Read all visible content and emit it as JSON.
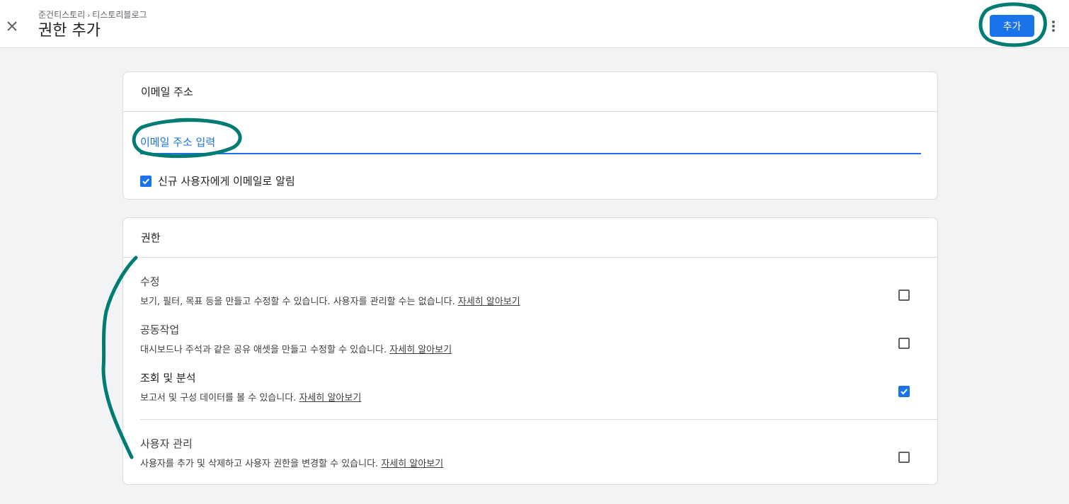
{
  "header": {
    "breadcrumb": [
      "준건티스토리",
      "티스토리블로그"
    ],
    "title": "권한 추가",
    "add_button_label": "추가"
  },
  "email_card": {
    "heading": "이메일 주소",
    "input_placeholder": "이메일 주소 입력",
    "input_value": "",
    "notify_label": "신규 사용자에게 이메일로 알림",
    "notify_checked": true
  },
  "permissions_card": {
    "heading": "권한",
    "items": [
      {
        "title": "수정",
        "desc": "보기, 필터, 목표 등을 만들고 수정할 수 있습니다. 사용자를 관리할 수는 없습니다.",
        "link": "자세히 알아보기",
        "checked": false
      },
      {
        "title": "공동작업",
        "desc": "대시보드나 주석과 같은 공유 애셋을 만들고 수정할 수 있습니다.",
        "link": "자세히 알아보기",
        "checked": false
      },
      {
        "title": "조회 및 분석",
        "desc": "보고서 및 구성 데이터를 볼 수 있습니다.",
        "link": "자세히 알아보기",
        "checked": true
      },
      {
        "title": "사용자 관리",
        "desc": "사용자를 추가 및 삭제하고 사용자 권한을 변경할 수 있습니다.",
        "link": "자세히 알아보기",
        "checked": false
      }
    ]
  },
  "colors": {
    "accent": "#1a73e8",
    "annotation": "#007c72"
  },
  "icons": {
    "close": "close-icon",
    "more": "more-vert-icon",
    "check": "check-icon"
  }
}
